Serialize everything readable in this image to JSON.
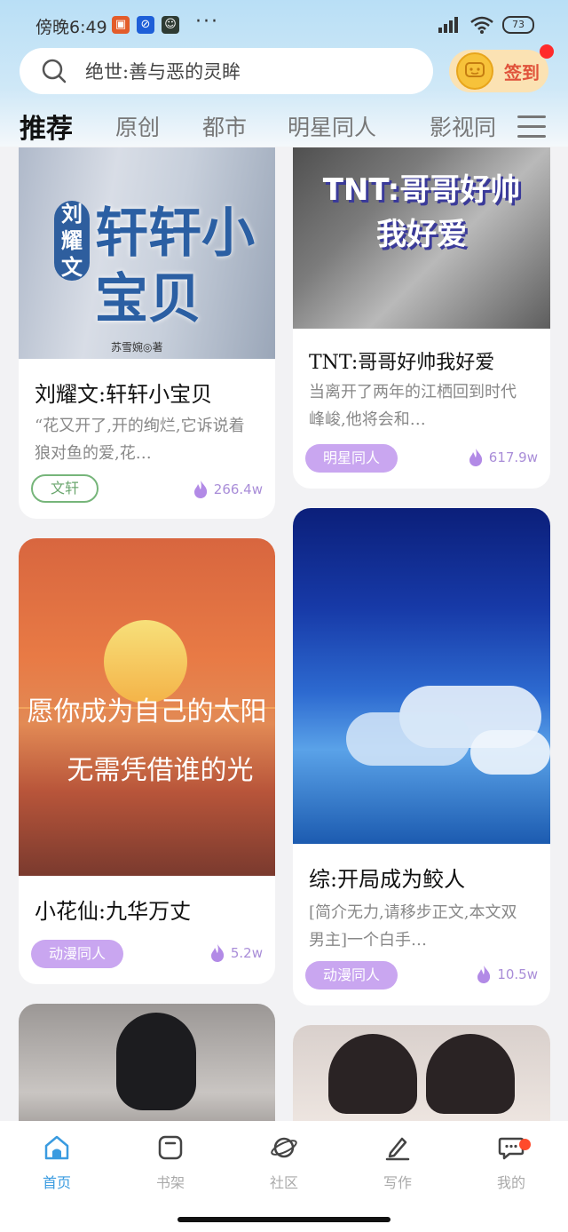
{
  "status_bar": {
    "time": "傍晚6:49",
    "battery": "73"
  },
  "search": {
    "placeholder": "绝世:善与恶的灵眸"
  },
  "checkin": {
    "label": "签到"
  },
  "tabs": [
    {
      "label": "推荐",
      "active": true
    },
    {
      "label": "原创"
    },
    {
      "label": "都市"
    },
    {
      "label": "明星同人"
    },
    {
      "label": "影视同"
    }
  ],
  "cards": [
    {
      "cover_title": "轩轩小宝贝",
      "cover_vertical": "刘耀文",
      "cover_author": "苏雪婉◎著",
      "title": "刘耀文:轩轩小宝贝",
      "desc": "“花又开了,开的绚烂,它诉说着狼对鱼的爱,花…",
      "tag": "文轩",
      "heat": "266.4w"
    },
    {
      "cover_line1": "TNT:哥哥好帅",
      "cover_line2": "我好爱",
      "title": "TNT:哥哥好帅我好爱",
      "desc": "当离开了两年的江栖回到时代峰峻,他将会和…",
      "tag": "明星同人",
      "heat": "617.9w"
    },
    {
      "cover_line1": "愿你成为自己的太阳",
      "cover_line2": "无需凭借谁的光",
      "title": "小花仙:九华万丈",
      "tag": "动漫同人",
      "heat": "5.2w"
    },
    {
      "title": "综:开局成为鲛人",
      "desc": "[简介无力,请移步正文,本文双男主]一个白手…",
      "tag": "动漫同人",
      "heat": "10.5w"
    }
  ],
  "bottom_nav": [
    {
      "label": "首页",
      "icon": "home-icon",
      "active": true
    },
    {
      "label": "书架",
      "icon": "bookshelf-icon"
    },
    {
      "label": "社区",
      "icon": "planet-icon"
    },
    {
      "label": "写作",
      "icon": "pen-icon"
    },
    {
      "label": "我的",
      "icon": "chat-icon",
      "badge": true
    }
  ],
  "colors": {
    "accent": "#3a9be0",
    "tag_purple": "#c9a6f0",
    "tag_green": "#76b57a",
    "badge_red": "#ff2b2b"
  }
}
